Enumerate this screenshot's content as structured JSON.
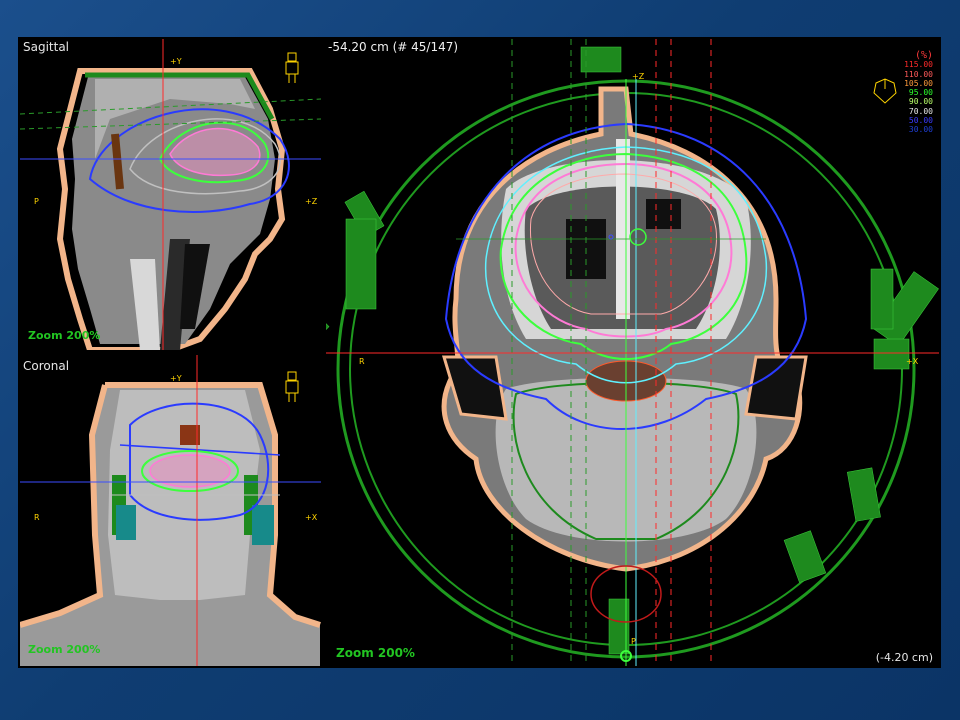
{
  "sagittal": {
    "title": "Sagittal",
    "axis_top": "+Y",
    "axis_left": "P",
    "axis_right": "+Z",
    "zoom": "Zoom 200%",
    "orientation_icon": "patient-figure-icon"
  },
  "coronal": {
    "title": "Coronal",
    "axis_top": "+Y",
    "axis_left": "R",
    "axis_right": "+X",
    "zoom": "Zoom 200%",
    "orientation_icon": "patient-figure-icon"
  },
  "axial": {
    "slice_info": "-54.20 cm (# 45/147)",
    "axis_top": "+Z",
    "axis_left": "R",
    "axis_right": "+X",
    "axis_bottom": "P",
    "zoom": "Zoom 200%",
    "position_readout": "(-4.20 cm)",
    "orientation_icon": "head-orientation-icon"
  },
  "isodose_legend": {
    "header": "(%)",
    "levels": [
      {
        "label": "115.00",
        "color": "#ff2b2b"
      },
      {
        "label": "110.00",
        "color": "#ff5a5a"
      },
      {
        "label": "105.00",
        "color": "#ff9a3c"
      },
      {
        "label": "95.00",
        "color": "#2cff2c"
      },
      {
        "label": "90.00",
        "color": "#b9ff6a"
      },
      {
        "label": "70.00",
        "color": "#e8e8e8"
      },
      {
        "label": "50.00",
        "color": "#3a3aff"
      },
      {
        "label": "30.00",
        "color": "#1f3fd8"
      }
    ]
  },
  "colors": {
    "beam_ring": "#1f9a1f",
    "skin_contour": "#f2b58a",
    "crosshair_red": "#ff2a2a",
    "crosshair_blue": "#3b4dff"
  }
}
